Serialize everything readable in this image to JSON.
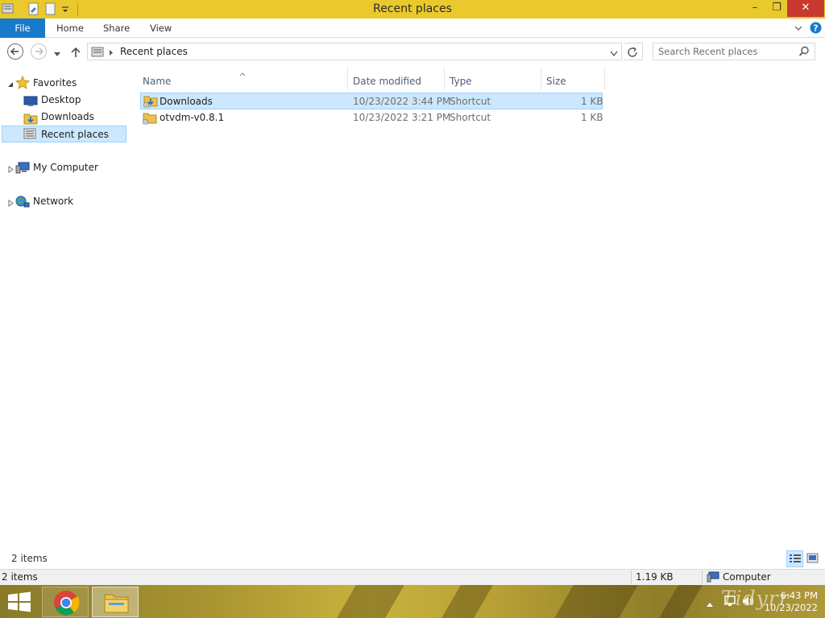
{
  "window": {
    "title": "Recent places",
    "minimize": "–",
    "restore": "❐",
    "close": "✕"
  },
  "ribbon": {
    "file": "File",
    "tabs": [
      "Home",
      "Share",
      "View"
    ]
  },
  "address": {
    "crumb": "Recent places",
    "search_placeholder": "Search Recent places"
  },
  "navpane": {
    "favorites": "Favorites",
    "items": [
      "Desktop",
      "Downloads",
      "Recent places"
    ],
    "computer": "My Computer",
    "network": "Network"
  },
  "columns": {
    "name": "Name",
    "date": "Date modified",
    "type": "Type",
    "size": "Size"
  },
  "files": [
    {
      "name": "Downloads",
      "date": "10/23/2022 3:44 PM",
      "type": "Shortcut",
      "size": "1 KB"
    },
    {
      "name": "otvdm-v0.8.1",
      "date": "10/23/2022 3:21 PM",
      "type": "Shortcut",
      "size": "1 KB"
    }
  ],
  "status": {
    "count": "2 items"
  },
  "details": {
    "count": "2 items",
    "size": "1.19 KB",
    "location": "Computer"
  },
  "taskbar": {
    "time": "6:43 PM",
    "date": "10/23/2022",
    "watermark": "Tidyrr"
  },
  "colors": {
    "titlebar": "#e9c92b",
    "file_tab": "#1979ca",
    "selection": "#cce8ff",
    "close": "#c7392f"
  }
}
